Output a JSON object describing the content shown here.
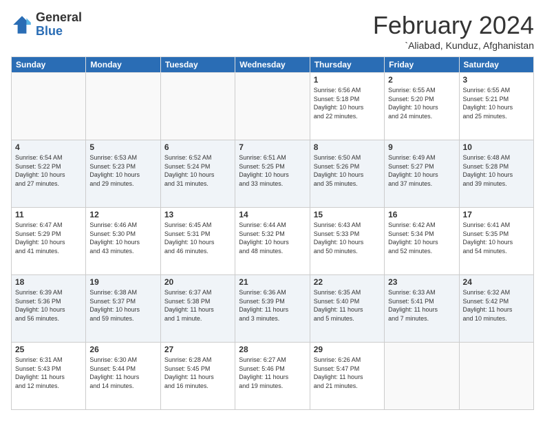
{
  "header": {
    "logo_general": "General",
    "logo_blue": "Blue",
    "month_title": "February 2024",
    "location": "`Aliabad, Kunduz, Afghanistan"
  },
  "weekdays": [
    "Sunday",
    "Monday",
    "Tuesday",
    "Wednesday",
    "Thursday",
    "Friday",
    "Saturday"
  ],
  "weeks": [
    [
      {
        "day": "",
        "info": ""
      },
      {
        "day": "",
        "info": ""
      },
      {
        "day": "",
        "info": ""
      },
      {
        "day": "",
        "info": ""
      },
      {
        "day": "1",
        "info": "Sunrise: 6:56 AM\nSunset: 5:18 PM\nDaylight: 10 hours\nand 22 minutes."
      },
      {
        "day": "2",
        "info": "Sunrise: 6:55 AM\nSunset: 5:20 PM\nDaylight: 10 hours\nand 24 minutes."
      },
      {
        "day": "3",
        "info": "Sunrise: 6:55 AM\nSunset: 5:21 PM\nDaylight: 10 hours\nand 25 minutes."
      }
    ],
    [
      {
        "day": "4",
        "info": "Sunrise: 6:54 AM\nSunset: 5:22 PM\nDaylight: 10 hours\nand 27 minutes."
      },
      {
        "day": "5",
        "info": "Sunrise: 6:53 AM\nSunset: 5:23 PM\nDaylight: 10 hours\nand 29 minutes."
      },
      {
        "day": "6",
        "info": "Sunrise: 6:52 AM\nSunset: 5:24 PM\nDaylight: 10 hours\nand 31 minutes."
      },
      {
        "day": "7",
        "info": "Sunrise: 6:51 AM\nSunset: 5:25 PM\nDaylight: 10 hours\nand 33 minutes."
      },
      {
        "day": "8",
        "info": "Sunrise: 6:50 AM\nSunset: 5:26 PM\nDaylight: 10 hours\nand 35 minutes."
      },
      {
        "day": "9",
        "info": "Sunrise: 6:49 AM\nSunset: 5:27 PM\nDaylight: 10 hours\nand 37 minutes."
      },
      {
        "day": "10",
        "info": "Sunrise: 6:48 AM\nSunset: 5:28 PM\nDaylight: 10 hours\nand 39 minutes."
      }
    ],
    [
      {
        "day": "11",
        "info": "Sunrise: 6:47 AM\nSunset: 5:29 PM\nDaylight: 10 hours\nand 41 minutes."
      },
      {
        "day": "12",
        "info": "Sunrise: 6:46 AM\nSunset: 5:30 PM\nDaylight: 10 hours\nand 43 minutes."
      },
      {
        "day": "13",
        "info": "Sunrise: 6:45 AM\nSunset: 5:31 PM\nDaylight: 10 hours\nand 46 minutes."
      },
      {
        "day": "14",
        "info": "Sunrise: 6:44 AM\nSunset: 5:32 PM\nDaylight: 10 hours\nand 48 minutes."
      },
      {
        "day": "15",
        "info": "Sunrise: 6:43 AM\nSunset: 5:33 PM\nDaylight: 10 hours\nand 50 minutes."
      },
      {
        "day": "16",
        "info": "Sunrise: 6:42 AM\nSunset: 5:34 PM\nDaylight: 10 hours\nand 52 minutes."
      },
      {
        "day": "17",
        "info": "Sunrise: 6:41 AM\nSunset: 5:35 PM\nDaylight: 10 hours\nand 54 minutes."
      }
    ],
    [
      {
        "day": "18",
        "info": "Sunrise: 6:39 AM\nSunset: 5:36 PM\nDaylight: 10 hours\nand 56 minutes."
      },
      {
        "day": "19",
        "info": "Sunrise: 6:38 AM\nSunset: 5:37 PM\nDaylight: 10 hours\nand 59 minutes."
      },
      {
        "day": "20",
        "info": "Sunrise: 6:37 AM\nSunset: 5:38 PM\nDaylight: 11 hours\nand 1 minute."
      },
      {
        "day": "21",
        "info": "Sunrise: 6:36 AM\nSunset: 5:39 PM\nDaylight: 11 hours\nand 3 minutes."
      },
      {
        "day": "22",
        "info": "Sunrise: 6:35 AM\nSunset: 5:40 PM\nDaylight: 11 hours\nand 5 minutes."
      },
      {
        "day": "23",
        "info": "Sunrise: 6:33 AM\nSunset: 5:41 PM\nDaylight: 11 hours\nand 7 minutes."
      },
      {
        "day": "24",
        "info": "Sunrise: 6:32 AM\nSunset: 5:42 PM\nDaylight: 11 hours\nand 10 minutes."
      }
    ],
    [
      {
        "day": "25",
        "info": "Sunrise: 6:31 AM\nSunset: 5:43 PM\nDaylight: 11 hours\nand 12 minutes."
      },
      {
        "day": "26",
        "info": "Sunrise: 6:30 AM\nSunset: 5:44 PM\nDaylight: 11 hours\nand 14 minutes."
      },
      {
        "day": "27",
        "info": "Sunrise: 6:28 AM\nSunset: 5:45 PM\nDaylight: 11 hours\nand 16 minutes."
      },
      {
        "day": "28",
        "info": "Sunrise: 6:27 AM\nSunset: 5:46 PM\nDaylight: 11 hours\nand 19 minutes."
      },
      {
        "day": "29",
        "info": "Sunrise: 6:26 AM\nSunset: 5:47 PM\nDaylight: 11 hours\nand 21 minutes."
      },
      {
        "day": "",
        "info": ""
      },
      {
        "day": "",
        "info": ""
      }
    ]
  ]
}
